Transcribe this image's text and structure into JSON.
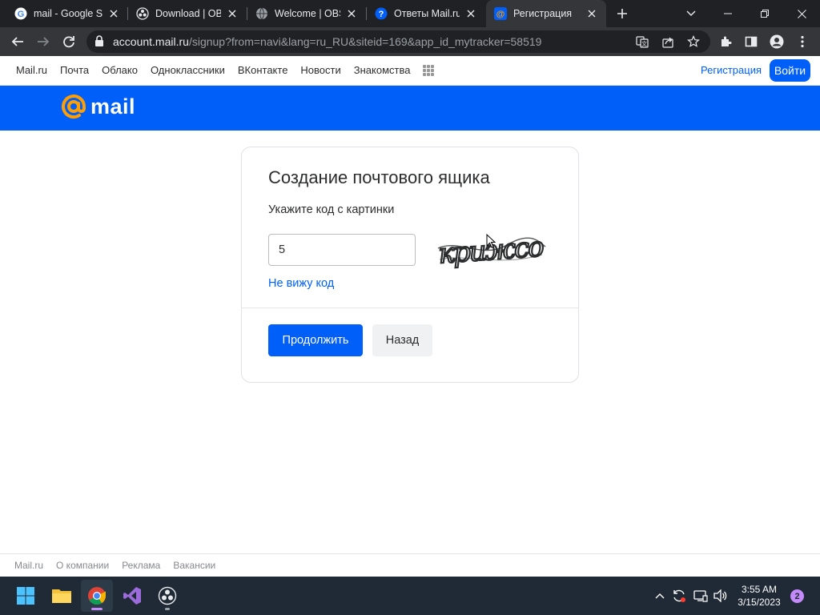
{
  "browser": {
    "tabs": [
      {
        "title": "mail - Google Se",
        "favicon": "google-g-icon"
      },
      {
        "title": "Download | OBS",
        "favicon": "obs-icon"
      },
      {
        "title": "Welcome | OBS",
        "favicon": "globe-icon"
      },
      {
        "title": "Ответы Mail.ru:",
        "favicon": "otvety-icon"
      },
      {
        "title": "Регистрация",
        "favicon": "mail-at-icon"
      }
    ],
    "active_tab_index": 4,
    "url_host": "account.mail.ru",
    "url_path": "/signup?from=navi&lang=ru_RU&siteid=169&app_id_mytracker=58519"
  },
  "portal_nav": {
    "links": [
      "Mail.ru",
      "Почта",
      "Облако",
      "Одноклассники",
      "ВКонтакте",
      "Новости",
      "Знакомства"
    ],
    "register": "Регистрация",
    "login": "Войти"
  },
  "brand": {
    "logo_text": "mail",
    "colors": {
      "accent": "#005ff9",
      "logo_at": "#ff9e00"
    }
  },
  "form": {
    "title": "Создание почтового ящика",
    "prompt": "Укажите код с картинки",
    "code_value": "5",
    "captcha_text": "крижсо",
    "cant_see_link": "Не вижу код",
    "continue_button": "Продолжить",
    "back_button": "Назад"
  },
  "footer": {
    "links": [
      "Mail.ru",
      "О компании",
      "Реклама",
      "Вакансии"
    ]
  },
  "taskbar": {
    "apps": [
      "windows-start-icon",
      "file-explorer-icon",
      "chrome-icon",
      "visual-studio-icon",
      "obs-icon"
    ],
    "time": "3:55 AM",
    "date": "3/15/2023",
    "notification_count": "2"
  }
}
